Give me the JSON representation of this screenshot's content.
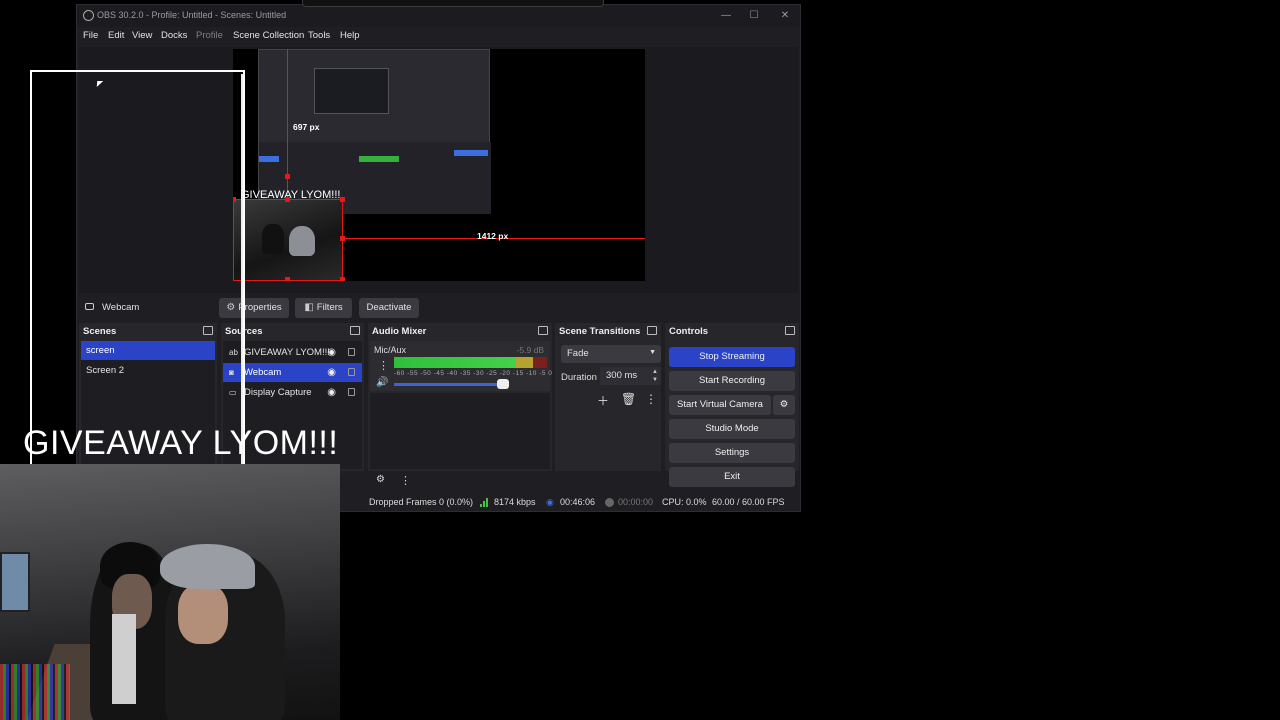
{
  "window": {
    "title": "OBS 30.2.0 - Profile: Untitled - Scenes: Untitled",
    "minimize": "—",
    "maximize": "☐",
    "close": "✕"
  },
  "menu": [
    "File",
    "Edit",
    "View",
    "Docks",
    "Profile",
    "Scene Collection",
    "Tools",
    "Help"
  ],
  "preview": {
    "canvas_text": "GIVEAWAY LYOM!!!",
    "height_label": "697 px",
    "width_label": "1412 px"
  },
  "source_toolbar": {
    "selected_source": "Webcam",
    "properties": "Properties",
    "filters": "Filters",
    "deactivate": "Deactivate"
  },
  "scenes": {
    "title": "Scenes",
    "items": [
      {
        "label": "screen",
        "selected": true
      },
      {
        "label": "Screen 2",
        "selected": false
      }
    ]
  },
  "sources": {
    "title": "Sources",
    "items": [
      {
        "label": "GIVEAWAY LYOM!!!",
        "icon": "text-icon",
        "glyph": "ab",
        "selected": false
      },
      {
        "label": "Webcam",
        "icon": "camera-icon",
        "glyph": "◙",
        "selected": true
      },
      {
        "label": "Display Capture",
        "icon": "monitor-icon",
        "glyph": "▭",
        "selected": false
      }
    ]
  },
  "mixer": {
    "title": "Audio Mixer",
    "channel": "Mic/Aux",
    "db": "-5.9 dB",
    "scale": "-60 -55 -50 -45 -40 -35 -30 -25 -20 -15 -10 -5 0",
    "volume_level": 0.74
  },
  "transitions": {
    "title": "Scene Transitions",
    "selected": "Fade",
    "duration_label": "Duration",
    "duration_value": "300 ms"
  },
  "controls": {
    "title": "Controls",
    "stop_streaming": "Stop Streaming",
    "start_recording": "Start Recording",
    "start_virtual_camera": "Start Virtual Camera",
    "studio_mode": "Studio Mode",
    "settings": "Settings",
    "exit": "Exit"
  },
  "status": {
    "dropped_frames": "Dropped Frames 0 (0.0%)",
    "bitrate": "8174 kbps",
    "stream_time": "00:46:06",
    "record_time": "00:00:00",
    "cpu": "CPU: 0.0%",
    "fps": "60.00 / 60.00 FPS"
  },
  "overlay": {
    "text": "GIVEAWAY LYOM!!!"
  },
  "colors": {
    "accent": "#2b44c7",
    "guide_red": "#e81818",
    "meter_green": "#2fbf3a"
  }
}
